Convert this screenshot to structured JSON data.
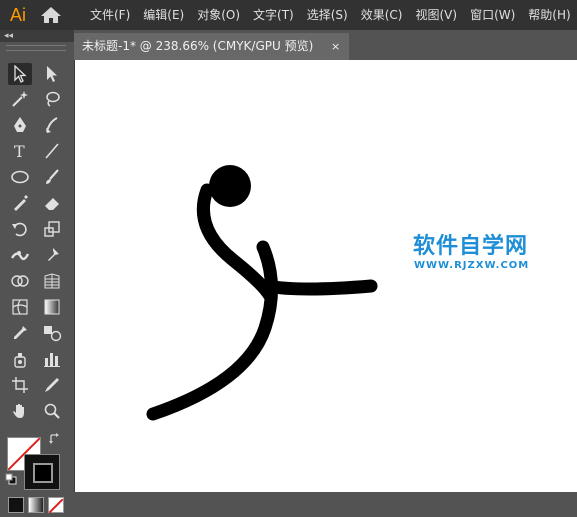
{
  "app": {
    "logo_text": "Ai",
    "menu": [
      "文件(F)",
      "编辑(E)",
      "对象(O)",
      "文字(T)",
      "选择(S)",
      "效果(C)",
      "视图(V)",
      "窗口(W)",
      "帮助(H)"
    ]
  },
  "panel": {
    "collapse_glyph": "◂◂",
    "tools": [
      "selection-tool",
      "direct-selection-tool",
      "magic-wand-tool",
      "lasso-tool",
      "pen-tool",
      "curvature-tool",
      "type-tool",
      "line-segment-tool",
      "ellipse-tool",
      "paintbrush-tool",
      "shaper-tool",
      "eraser-tool",
      "rotate-tool",
      "scale-tool",
      "width-tool",
      "puppet-warp-tool",
      "shape-builder-tool",
      "perspective-grid-tool",
      "mesh-tool",
      "gradient-tool",
      "eyedropper-tool",
      "blend-tool",
      "symbol-sprayer-tool",
      "column-graph-tool",
      "artboard-tool",
      "slice-tool",
      "hand-tool",
      "zoom-tool"
    ],
    "selected_tool": "selection-tool",
    "fill_color": "none",
    "stroke_color": "#000000"
  },
  "document": {
    "tab_title": "未标题-1* @ 238.66% (CMYK/GPU 预览)",
    "close_glyph": "×"
  },
  "watermark": {
    "title": "软件自学网",
    "url": "WWW.RJZXW.COM",
    "color": "#1e8fd6"
  },
  "artwork": {
    "stroke_color": "#000000"
  }
}
